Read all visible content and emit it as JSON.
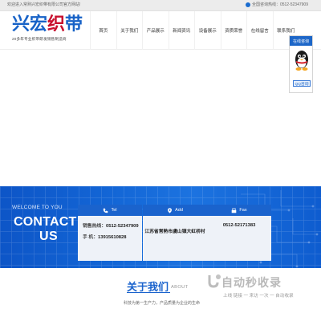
{
  "topbar": {
    "welcome": "欢迎进入常熟兴宏织带有限公司官方网站!",
    "hotline": "全国咨询热线：0512-52347909"
  },
  "logo": {
    "brand_part1": "兴宏",
    "brand_part2": "织",
    "brand_part3": "带",
    "slogan": "20多年专业织带研发销售制造商"
  },
  "nav": {
    "items": [
      {
        "label": "首页"
      },
      {
        "label": "关于我们"
      },
      {
        "label": "产品展示"
      },
      {
        "label": "新闻资讯"
      },
      {
        "label": "设备展示"
      },
      {
        "label": "资质荣誉"
      },
      {
        "label": "在线留言"
      },
      {
        "label": "联系我们"
      }
    ]
  },
  "service": {
    "title": "在线咨询",
    "qq_button": "QQ咨询"
  },
  "banner": {
    "welcome_en": "WELCOME TO YOU",
    "contact_line1": "CONTACT",
    "contact_line2": "US",
    "cards": [
      {
        "head": "Tel",
        "line1_label": "销售热线：",
        "line1_value": "0512-52347909",
        "line2_label": "手    机：",
        "line2_value": "13915610828"
      },
      {
        "head": "Add",
        "text": "江苏省常熟市虞山镇大虹桥村"
      },
      {
        "head": "Fax",
        "text": "0512-52171383"
      }
    ]
  },
  "about": {
    "title_cn": "关于我们",
    "title_en": "ABOUT",
    "intro": "科技为第一生产力，产品质量为企业的生命"
  },
  "watermark": {
    "title": "自动秒收录",
    "subtitle": "上线 链接 一 来访 一次 一 自动收录"
  },
  "colors": {
    "brand_blue": "#1762c7",
    "brand_red": "#c8102e",
    "banner_blue": "#1366d6"
  }
}
